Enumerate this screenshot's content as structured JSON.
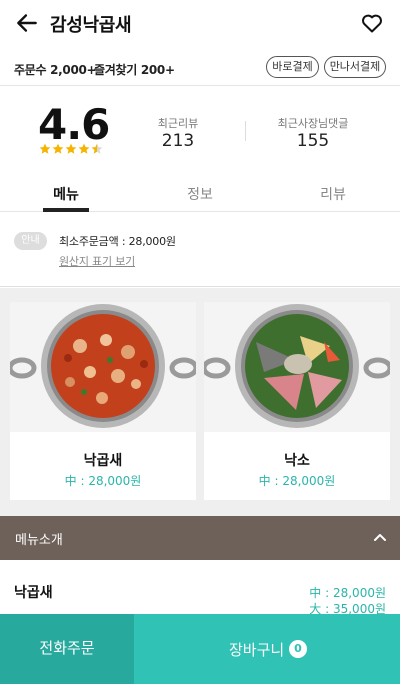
{
  "header": {
    "title": "감성낙곱새",
    "back_icon": "arrow-left-icon",
    "favorite_icon": "heart-outline-icon"
  },
  "stats": {
    "orders": "주문수 2,000+",
    "favorites": "즐겨찾기 200+"
  },
  "payment_badges": [
    "바로결제",
    "만나서결제"
  ],
  "rating": {
    "score": "4.6",
    "stars_filled": 4.5,
    "stars_total": 5,
    "star_color": "#f5b400"
  },
  "metrics": [
    {
      "label": "최근리뷰",
      "value": "213"
    },
    {
      "label": "최근사장님댓글",
      "value": "155"
    }
  ],
  "tabs": [
    {
      "label": "메뉴",
      "active": true
    },
    {
      "label": "정보",
      "active": false
    },
    {
      "label": "리뷰",
      "active": false
    }
  ],
  "notice": {
    "badge": "안내",
    "min_order": "최소주문금액 : 28,000원",
    "origin_link": "원산지 표기 보기"
  },
  "menu_cards": [
    {
      "name": "낙곱새",
      "price": "中 : 28,000원"
    },
    {
      "name": "낙소",
      "price": "中 : 28,000원"
    }
  ],
  "menu_intro": {
    "label": "메뉴소개",
    "icon": "chevron-up-icon"
  },
  "menu_row": {
    "name": "낙곱새",
    "prices": [
      "中 : 28,000원",
      "大 : 35,000원"
    ]
  },
  "bottom_bar": {
    "phone_order": "전화주문",
    "cart": "장바구니",
    "cart_count": "0"
  },
  "colors": {
    "accent": "#2fc2b5",
    "accent_dark": "#28a99e",
    "intro_bar": "#6e615a"
  }
}
